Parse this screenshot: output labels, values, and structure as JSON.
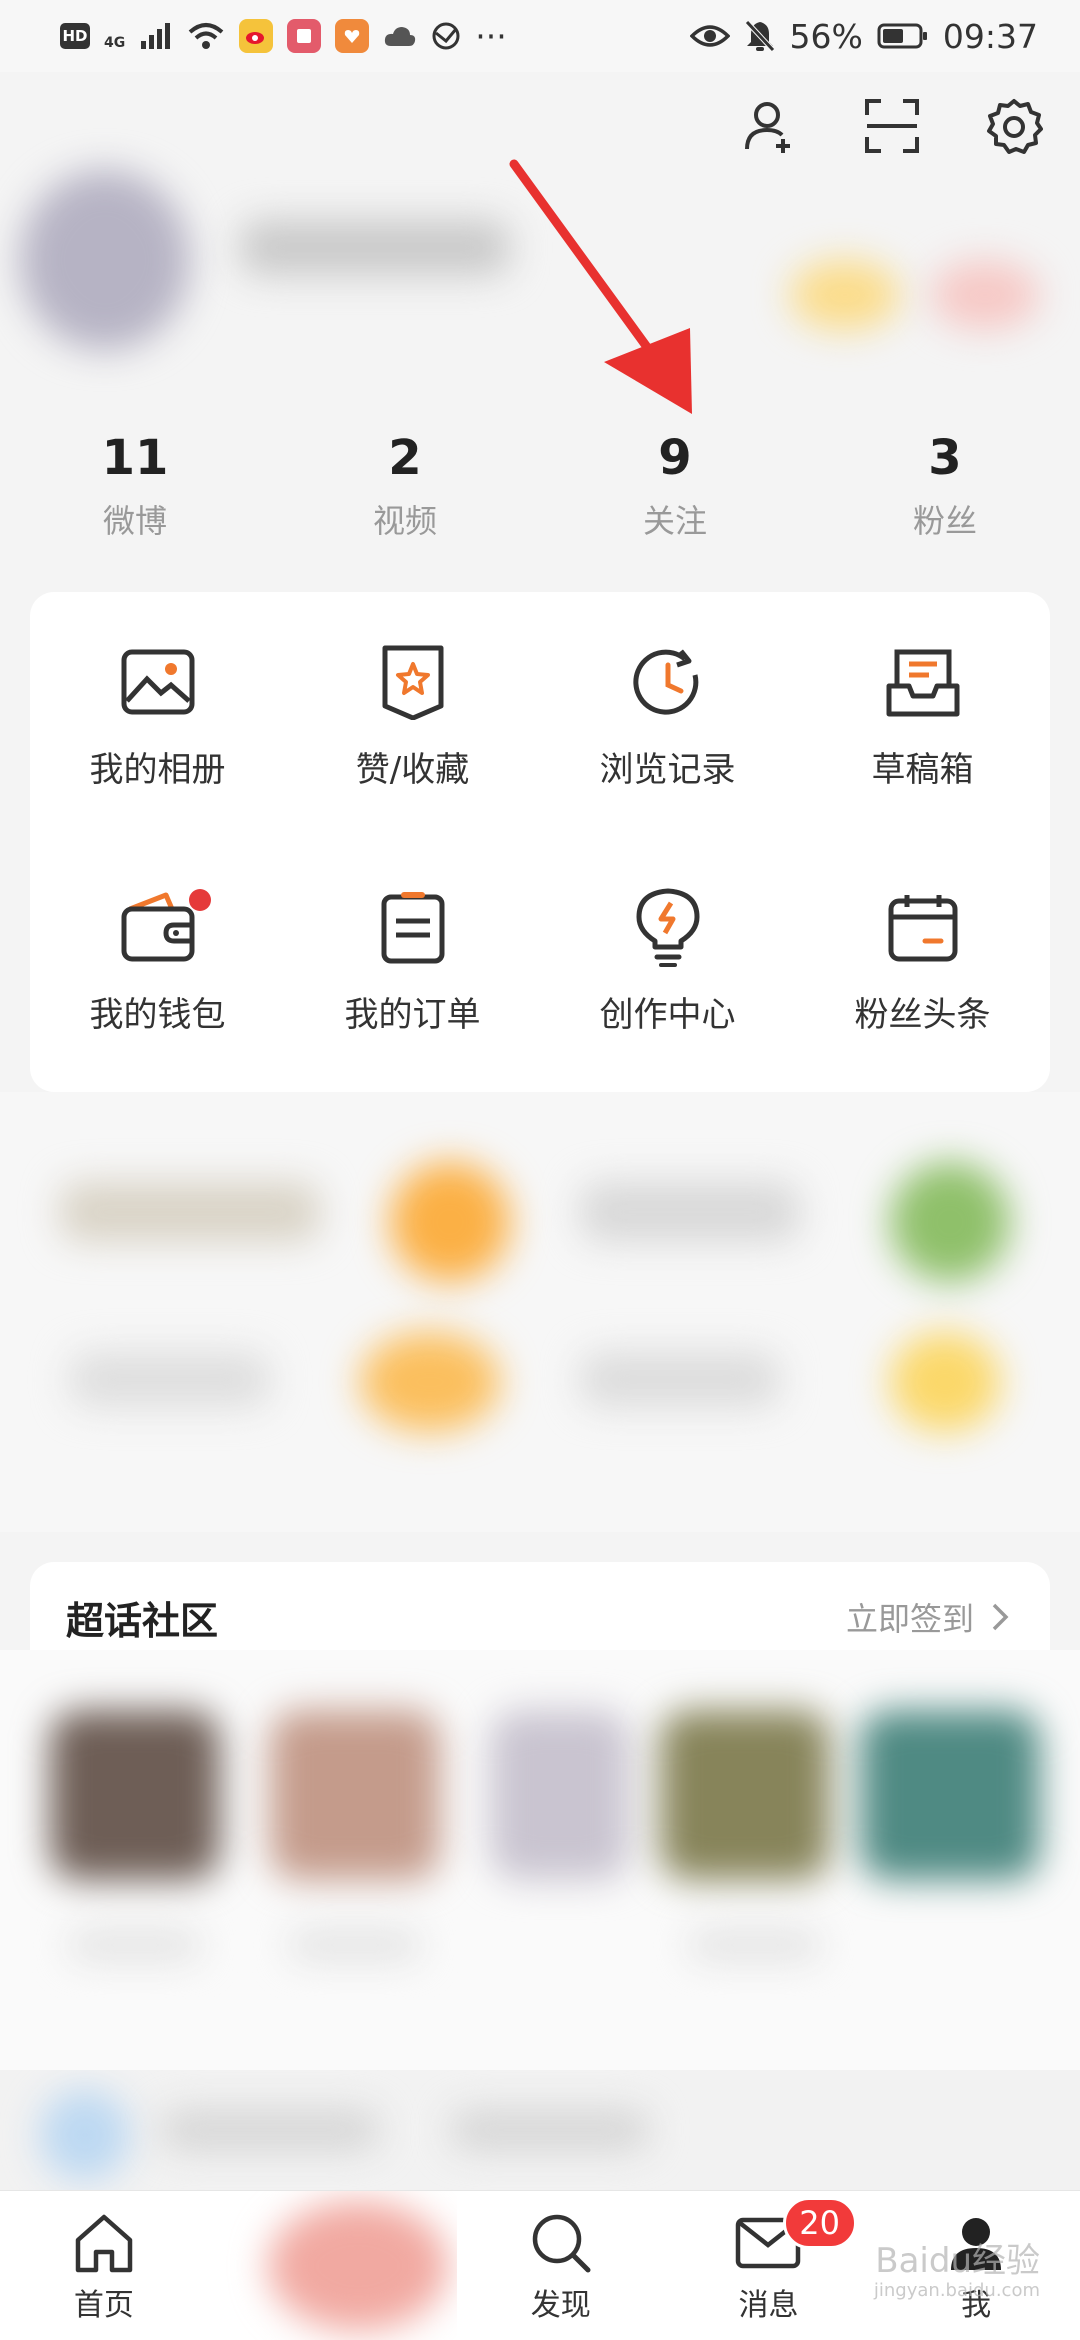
{
  "status_bar": {
    "left_labels": [
      "HD",
      "4G"
    ],
    "more": "···",
    "battery": "56%",
    "time": "09:37"
  },
  "header": {
    "icons": [
      "add-friend-icon",
      "scan-icon",
      "settings-icon"
    ]
  },
  "stats": [
    {
      "value": "11",
      "label": "微博"
    },
    {
      "value": "2",
      "label": "视频"
    },
    {
      "value": "9",
      "label": "关注"
    },
    {
      "value": "3",
      "label": "粉丝"
    }
  ],
  "menu": [
    {
      "label": "我的相册",
      "icon": "photo-album-icon"
    },
    {
      "label": "赞/收藏",
      "icon": "favorites-icon"
    },
    {
      "label": "浏览记录",
      "icon": "history-icon"
    },
    {
      "label": "草稿箱",
      "icon": "drafts-icon"
    },
    {
      "label": "我的钱包",
      "icon": "wallet-icon"
    },
    {
      "label": "我的订单",
      "icon": "orders-icon"
    },
    {
      "label": "创作中心",
      "icon": "creator-center-icon"
    },
    {
      "label": "粉丝头条",
      "icon": "fans-headline-icon"
    }
  ],
  "super_topic": {
    "title": "超话社区",
    "action": "立即签到"
  },
  "bottom_nav": {
    "home": "首页",
    "discover": "发现",
    "messages": "消息",
    "messages_badge": "20",
    "me": "我"
  },
  "watermark": {
    "brand": "Baidu经验",
    "url": "jingyan.baidu.com"
  },
  "colors": {
    "accent": "#f0782d",
    "badge": "#f23a3a",
    "arrow": "#e8312f"
  }
}
